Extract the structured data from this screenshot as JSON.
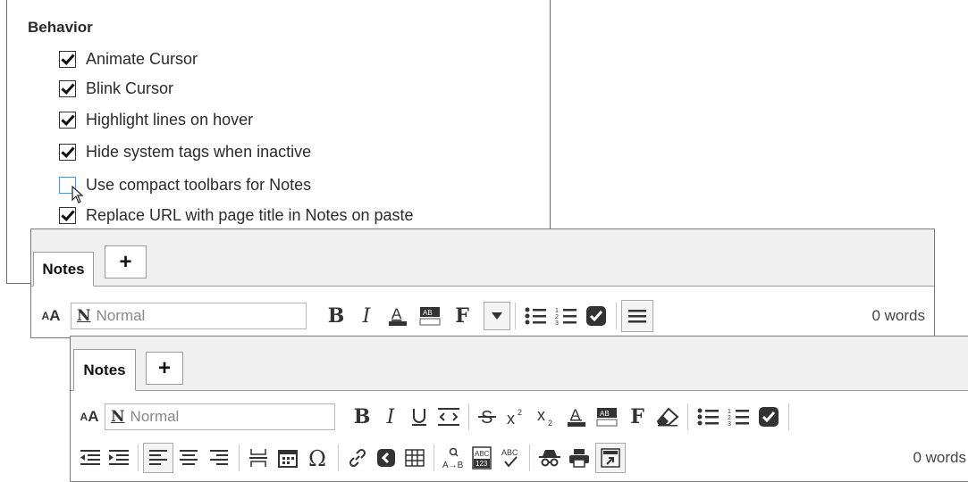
{
  "settings": {
    "title": "Behavior",
    "options": [
      {
        "label": "Animate Cursor",
        "checked": true
      },
      {
        "label": "Blink Cursor",
        "checked": true
      },
      {
        "label": "Highlight lines on hover",
        "checked": true
      },
      {
        "label": "Hide system tags when inactive",
        "checked": true
      },
      {
        "label": "Use compact toolbars for Notes",
        "checked": false
      },
      {
        "label": "Replace URL with page title in Notes on paste",
        "checked": true
      }
    ]
  },
  "compact_editor": {
    "tab_label": "Notes",
    "add_tab_label": "+",
    "text_size_label": "AA",
    "style_value": "Normal",
    "bold_label": "B",
    "italic_label": "I",
    "font_label": "F",
    "word_count": "0 words"
  },
  "full_editor": {
    "tab_label": "Notes",
    "add_tab_label": "+",
    "text_size_label": "AA",
    "style_value": "Normal",
    "bold_label": "B",
    "italic_label": "I",
    "font_label": "F",
    "word_count": "0 words"
  },
  "colors": {
    "accent_checkbox_hover": "#5b8fd3",
    "toolbar_icon": "#333333",
    "text_color_bar": "#333333"
  }
}
